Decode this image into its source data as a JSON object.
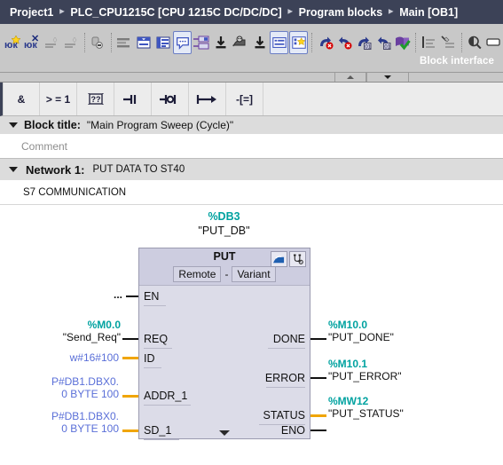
{
  "breadcrumb": {
    "items": [
      "Project1",
      "PLC_CPU1215C [CPU 1215C DC/DC/DC]",
      "Program blocks",
      "Main [OB1]"
    ],
    "separator": "▸"
  },
  "toolbar": {
    "block_interface_label": "Block interface",
    "buttons": [
      {
        "name": "insert-network-icon",
        "glyph": "Ю"
      },
      {
        "name": "delete-network-icon",
        "glyph": "Ю"
      },
      {
        "name": "collapse-all-icon",
        "glyph": "≡"
      },
      {
        "name": "expand-all-icon",
        "glyph": "≡"
      },
      {
        "name": "absolute-symbolic-icon",
        "glyph": "●"
      },
      {
        "name": "show-operand-list-icon",
        "glyph": "☰"
      },
      {
        "name": "network-overview-icon",
        "glyph": "▤"
      },
      {
        "name": "show-hide-favorites-icon",
        "glyph": "▥"
      },
      {
        "name": "comments-toggle-icon",
        "glyph": "○"
      },
      {
        "name": "rewire-icon",
        "glyph": "▦"
      },
      {
        "name": "download-to-device-icon",
        "glyph": "↓"
      },
      {
        "name": "monitoring-icon",
        "glyph": "◉"
      },
      {
        "name": "monitoring-download-icon",
        "glyph": "↓"
      },
      {
        "name": "show-block-interface-icon",
        "glyph": "▤"
      },
      {
        "name": "favorites-star-icon",
        "glyph": "★"
      },
      {
        "name": "undo-error-icon",
        "glyph": "↶"
      },
      {
        "name": "redo-error-icon",
        "glyph": "↷"
      },
      {
        "name": "go-to-next-error-icon",
        "glyph": "↶"
      },
      {
        "name": "go-to-previous-error-icon",
        "glyph": "↷"
      },
      {
        "name": "compile-ok-icon",
        "glyph": "✔"
      },
      {
        "name": "align-left-icon",
        "glyph": "≡"
      },
      {
        "name": "clear-formatting-icon",
        "glyph": "≡"
      },
      {
        "name": "zoom-icon",
        "glyph": "◑"
      },
      {
        "name": "tooltip-icon",
        "glyph": "▭"
      }
    ]
  },
  "lad_toolbar": {
    "buttons": [
      {
        "name": "and-box-button",
        "label": "&"
      },
      {
        "name": "or-box-button",
        "label": "> = 1"
      },
      {
        "name": "empty-box-button",
        "label": "??"
      },
      {
        "name": "no-contact-button",
        "label": "─|"
      },
      {
        "name": "nc-contact-button",
        "label": "─o|"
      },
      {
        "name": "open-branch-button",
        "label": "⟼"
      },
      {
        "name": "coil-button",
        "label": "-[=]"
      }
    ]
  },
  "block_title": {
    "label": "Block title:",
    "value": "\"Main Program Sweep (Cycle)\"",
    "comment_placeholder": "Comment"
  },
  "network": {
    "label": "Network 1:",
    "title": "PUT DATA TO ST40",
    "comment": "S7 COMMUNICATION"
  },
  "function_block": {
    "db_address": "%DB3",
    "db_name": "\"PUT_DB\"",
    "name": "PUT",
    "variant_left": "Remote",
    "variant_dash": "-",
    "variant_right": "Variant",
    "icons": [
      {
        "name": "block-call-icon",
        "glyph": "▰"
      },
      {
        "name": "block-diagnostics-icon",
        "glyph": "ʉ"
      }
    ],
    "inputs": [
      {
        "pin": "EN",
        "operand_addr": "",
        "operand_name": "...",
        "wire_color": "black",
        "style": "dots"
      },
      {
        "pin": "REQ",
        "operand_addr": "%M0.0",
        "operand_name": "\"Send_Req\"",
        "wire_color": "black",
        "style": "tag"
      },
      {
        "pin": "ID",
        "operand_addr": "",
        "operand_name": "w#16#100",
        "wire_color": "orange",
        "style": "blue"
      },
      {
        "pin": "ADDR_1",
        "operand_addr": "P#DB1.DBX0.",
        "operand_name": "0 BYTE 100",
        "wire_color": "orange",
        "style": "blue2"
      },
      {
        "pin": "SD_1",
        "operand_addr": "P#DB1.DBX0.",
        "operand_name": "0 BYTE 100",
        "wire_color": "orange",
        "style": "blue2"
      }
    ],
    "outputs": [
      {
        "pin": "DONE",
        "operand_addr": "%M10.0",
        "operand_name": "\"PUT_DONE\"",
        "wire_color": "black"
      },
      {
        "pin": "ERROR",
        "operand_addr": "%M10.1",
        "operand_name": "\"PUT_ERROR\"",
        "wire_color": "black"
      },
      {
        "pin": "STATUS",
        "operand_addr": "%MW12",
        "operand_name": "\"PUT_STATUS\"",
        "wire_color": "orange"
      },
      {
        "pin": "ENO",
        "operand_addr": "",
        "operand_name": "",
        "wire_color": "black"
      }
    ]
  },
  "colors": {
    "breadcrumb_bg": "#3c4257",
    "toolbar_bg": "#c8c8c8",
    "block_fill": "#dcdce8",
    "block_header_fill": "#cdcde0",
    "tag_teal": "#00a2a0",
    "constant_blue": "#5a6fd8",
    "wire_orange": "#f0a500",
    "wire_black": "#101010"
  }
}
